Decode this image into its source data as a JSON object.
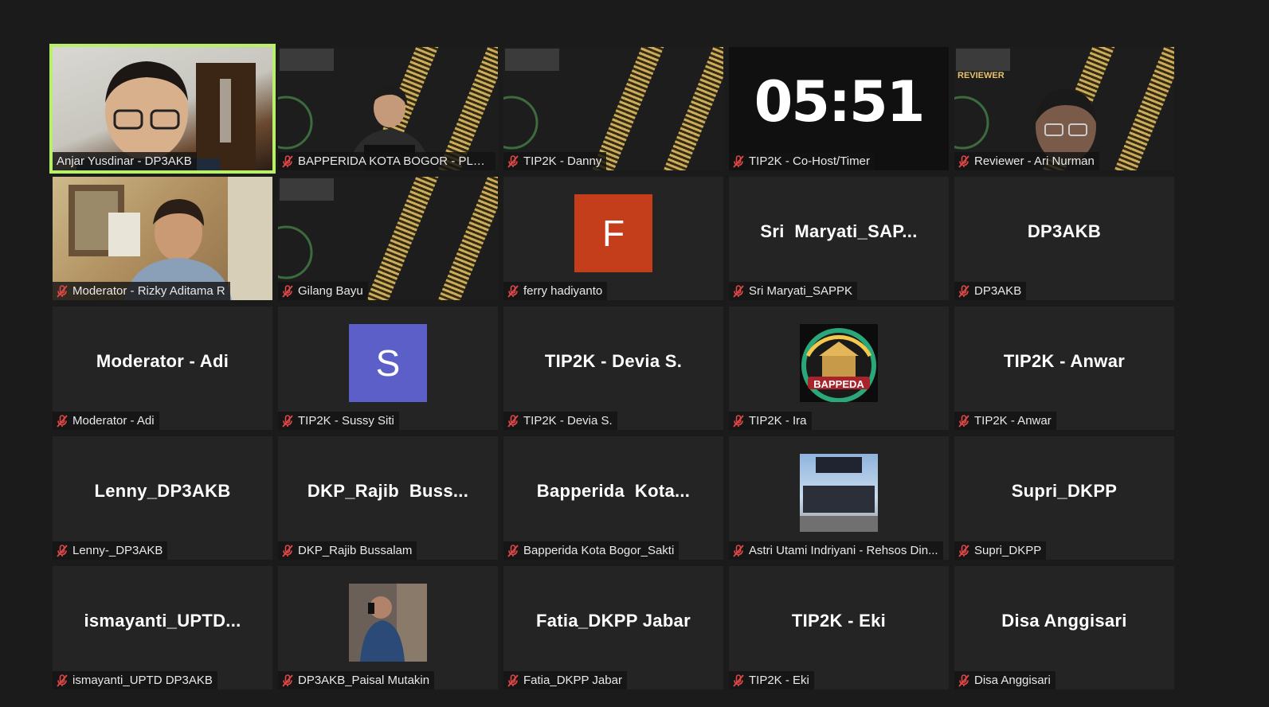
{
  "meeting": {
    "timer": "05:51",
    "review_tag": "REVIEWER",
    "tiles": [
      {
        "label": "Anjar Yusdinar - DP3AKB",
        "muted": false,
        "kind": "cam1",
        "active": true
      },
      {
        "label": "BAPPERIDA KOTA BOGOR - PLH K...",
        "muted": true,
        "kind": "slide-person"
      },
      {
        "label": "TIP2K - Danny",
        "muted": true,
        "kind": "slide"
      },
      {
        "label": "TIP2K - Co-Host/Timer",
        "muted": true,
        "kind": "timer"
      },
      {
        "label": "Reviewer - Ari Nurman",
        "muted": true,
        "kind": "slide-reviewer"
      },
      {
        "label": "Moderator - Rizky Aditama R",
        "muted": true,
        "kind": "cam2"
      },
      {
        "label": "Gilang Bayu",
        "muted": true,
        "kind": "slide"
      },
      {
        "label": "ferry hadiyanto",
        "muted": true,
        "kind": "avatar",
        "avatar_letter": "F",
        "avatar_color": "#c43e1c"
      },
      {
        "label": "Sri Maryati_SAPPK",
        "muted": true,
        "kind": "name",
        "big_name": "Sri  Maryati_SAP..."
      },
      {
        "label": "DP3AKB",
        "muted": true,
        "kind": "name",
        "big_name": "DP3AKB"
      },
      {
        "label": "Moderator - Adi",
        "muted": true,
        "kind": "name",
        "big_name": "Moderator - Adi"
      },
      {
        "label": "TIP2K - Sussy Siti",
        "muted": true,
        "kind": "avatar",
        "avatar_letter": "S",
        "avatar_color": "#5b5fc7"
      },
      {
        "label": "TIP2K - Devia S.",
        "muted": true,
        "kind": "name",
        "big_name": "TIP2K - Devia S."
      },
      {
        "label": "TIP2K - Ira",
        "muted": true,
        "kind": "logo",
        "logo_text": "BAPPEDA"
      },
      {
        "label": "TIP2K - Anwar",
        "muted": true,
        "kind": "name",
        "big_name": "TIP2K - Anwar"
      },
      {
        "label": "Lenny-_DP3AKB",
        "muted": true,
        "kind": "name",
        "big_name": "Lenny_DP3AKB"
      },
      {
        "label": "DKP_Rajib Bussalam",
        "muted": true,
        "kind": "name",
        "big_name": "DKP_Rajib  Buss..."
      },
      {
        "label": "Bapperida Kota Bogor_Sakti",
        "muted": true,
        "kind": "name",
        "big_name": "Bapperida  Kota..."
      },
      {
        "label": "Astri Utami Indriyani - Rehsos Din...",
        "muted": true,
        "kind": "photo-city"
      },
      {
        "label": "Supri_DKPP",
        "muted": true,
        "kind": "name",
        "big_name": "Supri_DKPP"
      },
      {
        "label": "ismayanti_UPTD DP3AKB",
        "muted": true,
        "kind": "name",
        "big_name": "ismayanti_UPTD..."
      },
      {
        "label": "DP3AKB_Paisal Mutakin",
        "muted": true,
        "kind": "photo-person"
      },
      {
        "label": "Fatia_DKPP Jabar",
        "muted": true,
        "kind": "name",
        "big_name": "Fatia_DKPP Jabar"
      },
      {
        "label": "TIP2K - Eki",
        "muted": true,
        "kind": "name",
        "big_name": "TIP2K - Eki"
      },
      {
        "label": "Disa Anggisari",
        "muted": true,
        "kind": "name",
        "big_name": "Disa Anggisari"
      }
    ]
  }
}
